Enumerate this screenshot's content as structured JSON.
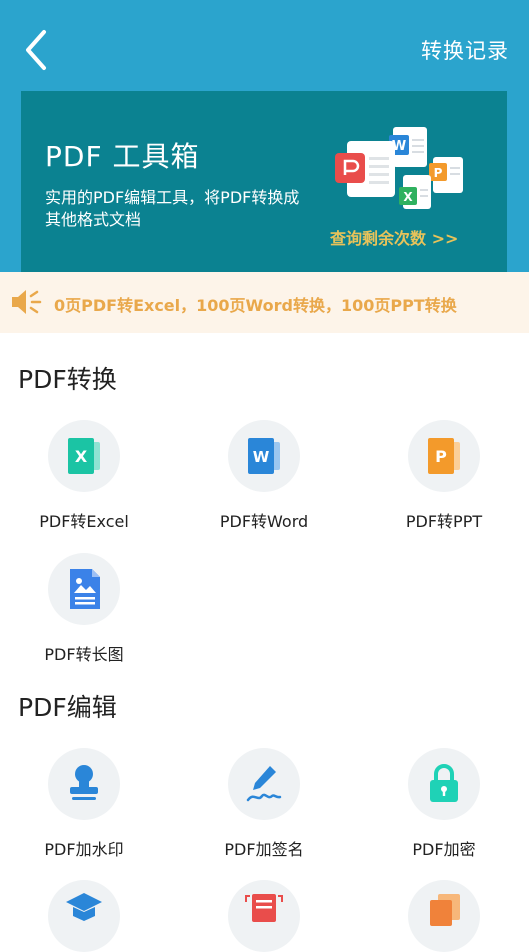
{
  "header": {
    "history_label": "转换记录",
    "card": {
      "title": "PDF 工具箱",
      "description": "实用的PDF编辑工具，将PDF转换成其他格式文档",
      "link": "查询剩余次数 >>"
    }
  },
  "notice": {
    "text": "0页PDF转Excel，100页Word转换，100页PPT转换"
  },
  "sections": [
    {
      "title": "PDF转换",
      "tools": [
        {
          "label": "PDF转Excel",
          "icon": "excel-icon"
        },
        {
          "label": "PDF转Word",
          "icon": "word-icon"
        },
        {
          "label": "PDF转PPT",
          "icon": "ppt-icon"
        },
        {
          "label": "PDF转长图",
          "icon": "image-doc-icon"
        }
      ]
    },
    {
      "title": "PDF编辑",
      "tools": [
        {
          "label": "PDF加水印",
          "icon": "stamp-icon"
        },
        {
          "label": "PDF加签名",
          "icon": "signature-pen-icon"
        },
        {
          "label": "PDF加密",
          "icon": "lock-icon"
        }
      ]
    }
  ],
  "colors": {
    "header_bg": "#2ba4cd",
    "card_bg": "#0b8291",
    "accent_gold": "#e8c35a",
    "notice_bg": "#fdf4e9",
    "notice_text": "#e9a84b",
    "excel": "#1bc4a4",
    "word": "#2a86d8",
    "ppt": "#f39a2b",
    "blue": "#3b82e8",
    "lock": "#1fd2b6"
  }
}
